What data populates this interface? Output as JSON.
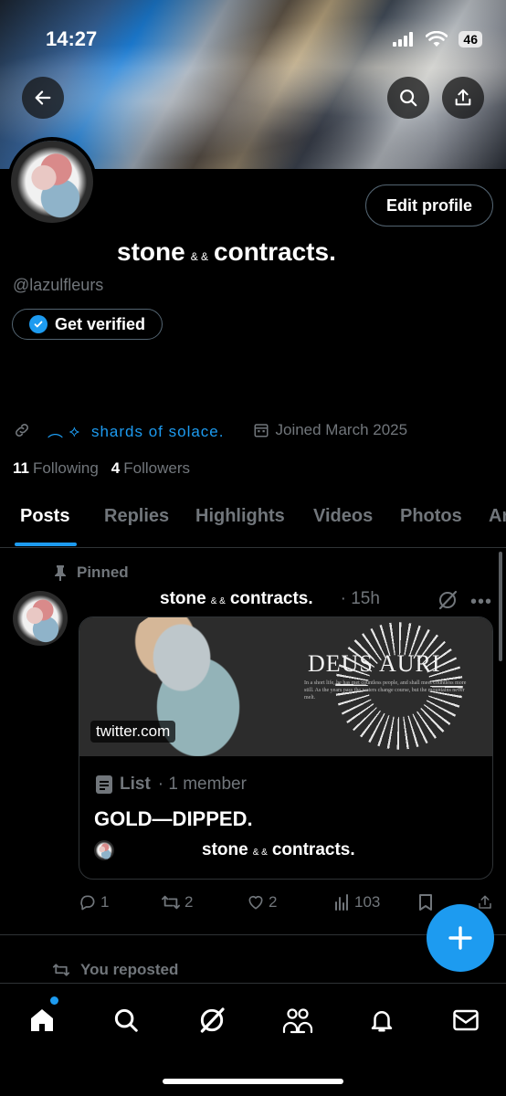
{
  "status_bar": {
    "time": "14:27",
    "battery": "46"
  },
  "profile": {
    "display_name_part1": "stone",
    "display_name_amp": "& &",
    "display_name_part2": "contracts.",
    "handle": "@lazulfleurs",
    "edit_profile_label": "Edit profile",
    "get_verified_label": "Get verified",
    "website_prefix": "︵ ⟡",
    "website_text": "shards of solace.",
    "joined_text": "Joined March 2025",
    "following_count": "11",
    "following_label": "Following",
    "followers_count": "4",
    "followers_label": "Followers"
  },
  "tabs": [
    "Posts",
    "Replies",
    "Highlights",
    "Videos",
    "Photos",
    "Ar"
  ],
  "pinned_post": {
    "pinned_label": "Pinned",
    "author_part1": "stone",
    "author_amp": "& &",
    "author_part2": "contracts.",
    "time": "· 15h",
    "card": {
      "image_title": "DEUS AURI",
      "image_small_text": "In a short life, he has met countless people, and shall meet countless more still. As the years pass the waters change course, but the mountains never melt.",
      "domain": "twitter.com",
      "list_label": "List",
      "member_count": "· 1 member",
      "list_title": "GOLD—DIPPED.",
      "owner_part1": "stone",
      "owner_amp": "& &",
      "owner_part2": "contracts."
    },
    "actions": {
      "replies": "1",
      "reposts": "2",
      "likes": "2",
      "views": "103"
    }
  },
  "next_post": {
    "repost_label": "You reposted"
  },
  "colors": {
    "accent": "#1d9bf0",
    "muted": "#71767b",
    "border": "#2f3336"
  }
}
